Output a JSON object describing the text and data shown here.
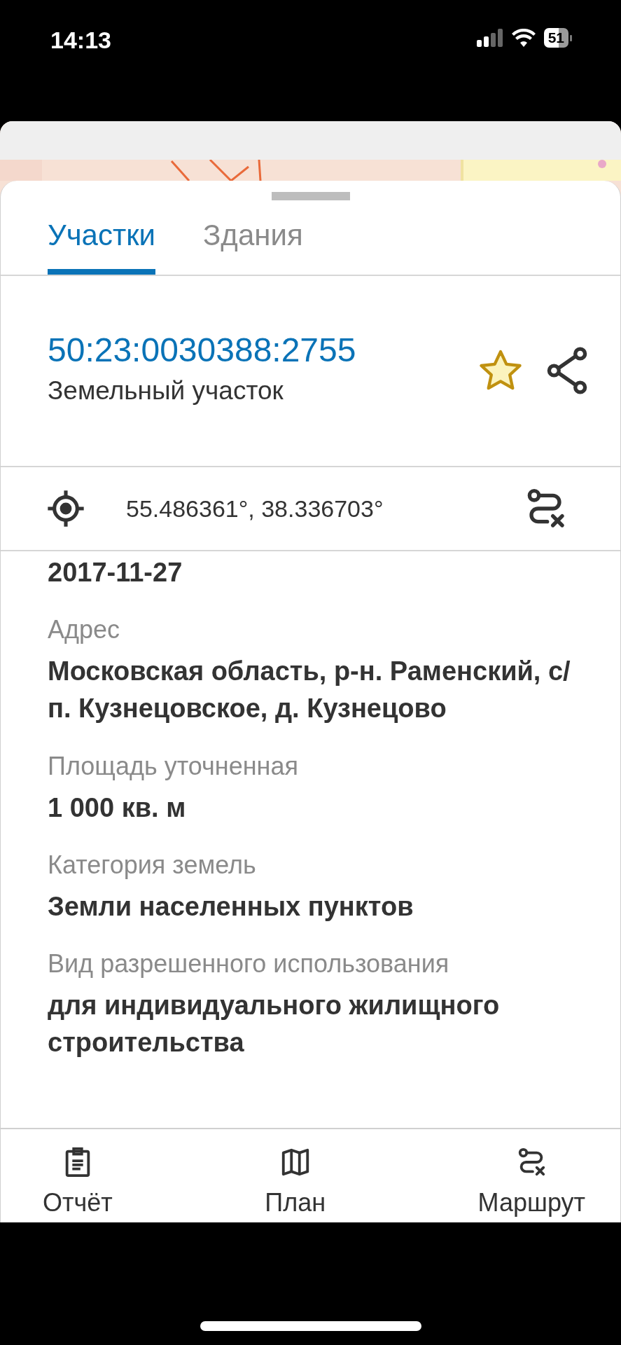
{
  "status_bar": {
    "time": "14:13",
    "battery": "51"
  },
  "tabs": [
    {
      "label": "Участки",
      "selected": true
    },
    {
      "label": "Здания",
      "selected": false
    }
  ],
  "parcel": {
    "number": "50:23:0030388:2755",
    "type": "Земельный участок",
    "favorite": true
  },
  "coordinates": "55.486361°, 38.336703°",
  "details": [
    {
      "value": "2017-11-27"
    },
    {
      "label": "Адрес",
      "value": "Московская область, р-н. Раменский, с/п. Кузнецовское, д. Кузнецово"
    },
    {
      "label": "Площадь уточненная",
      "value": "1 000 кв. м"
    },
    {
      "label": "Категория земель",
      "value": "Земли населенных пунктов"
    },
    {
      "label": "Вид разрешенного использования",
      "value": "для индивидуального жилищного строительства"
    }
  ],
  "bottom_nav": [
    {
      "label": "Отчёт",
      "kind": "report"
    },
    {
      "label": "План",
      "kind": "map"
    },
    {
      "label": "Маршрут",
      "kind": "route"
    }
  ]
}
